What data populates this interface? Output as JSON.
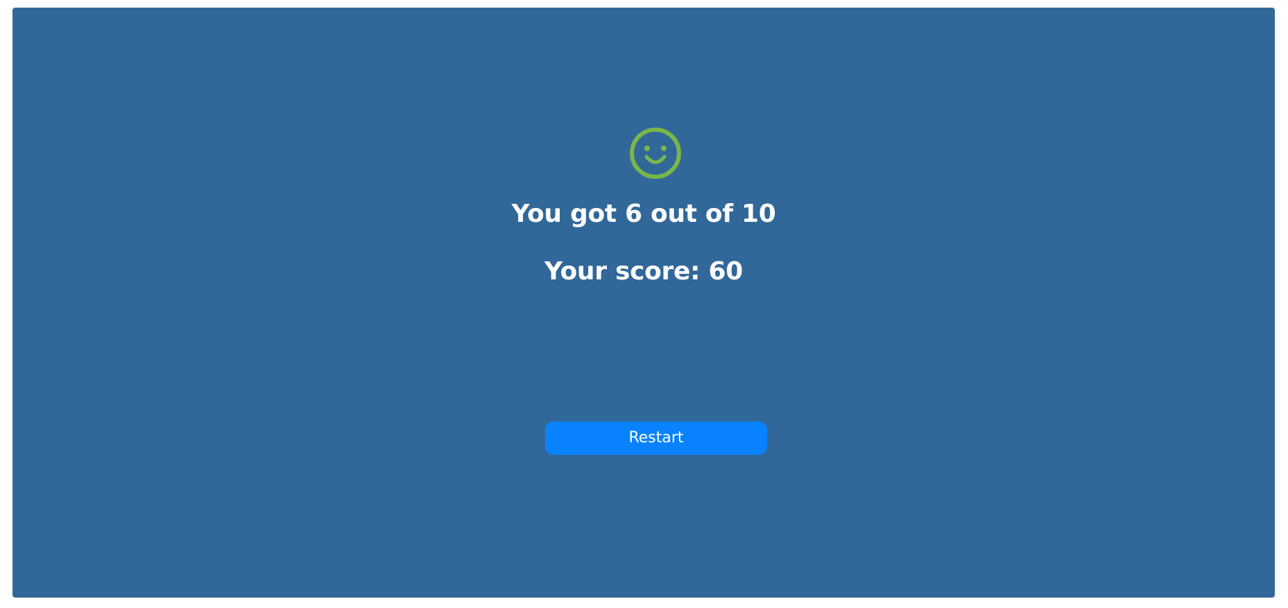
{
  "result": {
    "icon": "smiley-face-icon",
    "icon_color": "#7ab648",
    "correct_text": "You got 6 out of 10",
    "score_text": "Your score: 60"
  },
  "actions": {
    "restart_label": "Restart"
  },
  "colors": {
    "panel_background": "#326899",
    "button_background": "#0883fd",
    "text": "#ffffff"
  }
}
